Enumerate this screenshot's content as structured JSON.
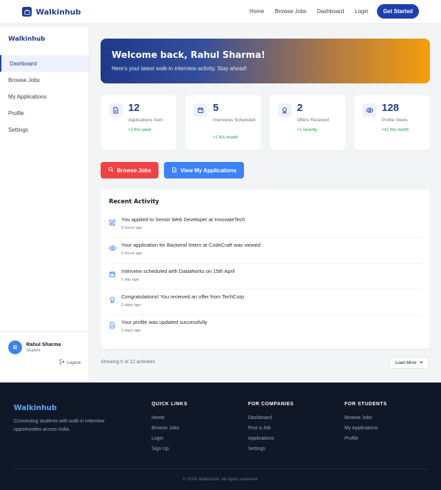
{
  "nav": {
    "brand": "Walkinhub",
    "links": [
      "Home",
      "Browse Jobs",
      "Dashboard",
      "Login"
    ],
    "cta": "Get Started"
  },
  "sidebar": {
    "title": "Walkinhub",
    "items": [
      "Dashboard",
      "Browse Jobs",
      "My Applications",
      "Profile",
      "Settings"
    ],
    "active": "Dashboard",
    "user": {
      "initial": "R",
      "name": "Rahul Sharma",
      "role": "Student"
    },
    "logout": "Logout"
  },
  "welcome": {
    "title": "Welcome back, Rahul Sharma!",
    "subtitle": "Here's your latest walk-in interview activity. Stay ahead!"
  },
  "stats": [
    {
      "value": "12",
      "label": "Applications Sent",
      "change": "+3 this week",
      "icon": "document-icon"
    },
    {
      "value": "5",
      "label": "Interviews Scheduled",
      "change": "+2 this month",
      "icon": "calendar-icon"
    },
    {
      "value": "2",
      "label": "Offers Received",
      "change": "+1 recently",
      "icon": "award-icon"
    },
    {
      "value": "128",
      "label": "Profile Views",
      "change": "+42 this month",
      "icon": "eye-icon"
    }
  ],
  "actions": {
    "browse": "Browse Jobs",
    "view": "View My Applications"
  },
  "activity": {
    "title": "Recent Activity",
    "items": [
      {
        "text": "You applied to Senior Web Developer at InnovateTech",
        "time": "2 hours ago",
        "icon": "edit-icon"
      },
      {
        "text": "Your application for Backend Intern at CodeCraft was viewed",
        "time": "5 hours ago",
        "icon": "eye-icon"
      },
      {
        "text": "Interview scheduled with DataWorks on 15th April",
        "time": "1 day ago",
        "icon": "calendar-icon"
      },
      {
        "text": "Congratulations! You received an offer from TechCorp",
        "time": "2 days ago",
        "icon": "award-icon"
      },
      {
        "text": "Your profile was updated successfully",
        "time": "3 days ago",
        "icon": "document-icon"
      }
    ],
    "showing": "Showing 5 of 12 activities",
    "load_more": "Load More"
  },
  "footer": {
    "brand": "Walkinhub",
    "description": "Connecting students with walk-in interview opportunities across India.",
    "columns": [
      {
        "heading": "QUICK LINKS",
        "links": [
          "Home",
          "Browse Jobs",
          "Login",
          "Sign Up"
        ]
      },
      {
        "heading": "FOR COMPANIES",
        "links": [
          "Dashboard",
          "Post a Job",
          "Applications",
          "Settings"
        ]
      },
      {
        "heading": "FOR STUDENTS",
        "links": [
          "Browse Jobs",
          "My Applications",
          "Profile"
        ]
      }
    ],
    "copyright": "© 2024 Walkinhub. All rights reserved."
  },
  "colors": {
    "brand": "#1e3a8a",
    "primary": "#3b82f6",
    "danger": "#ef4444",
    "success": "#16a34a",
    "footer_bg": "#101828"
  }
}
